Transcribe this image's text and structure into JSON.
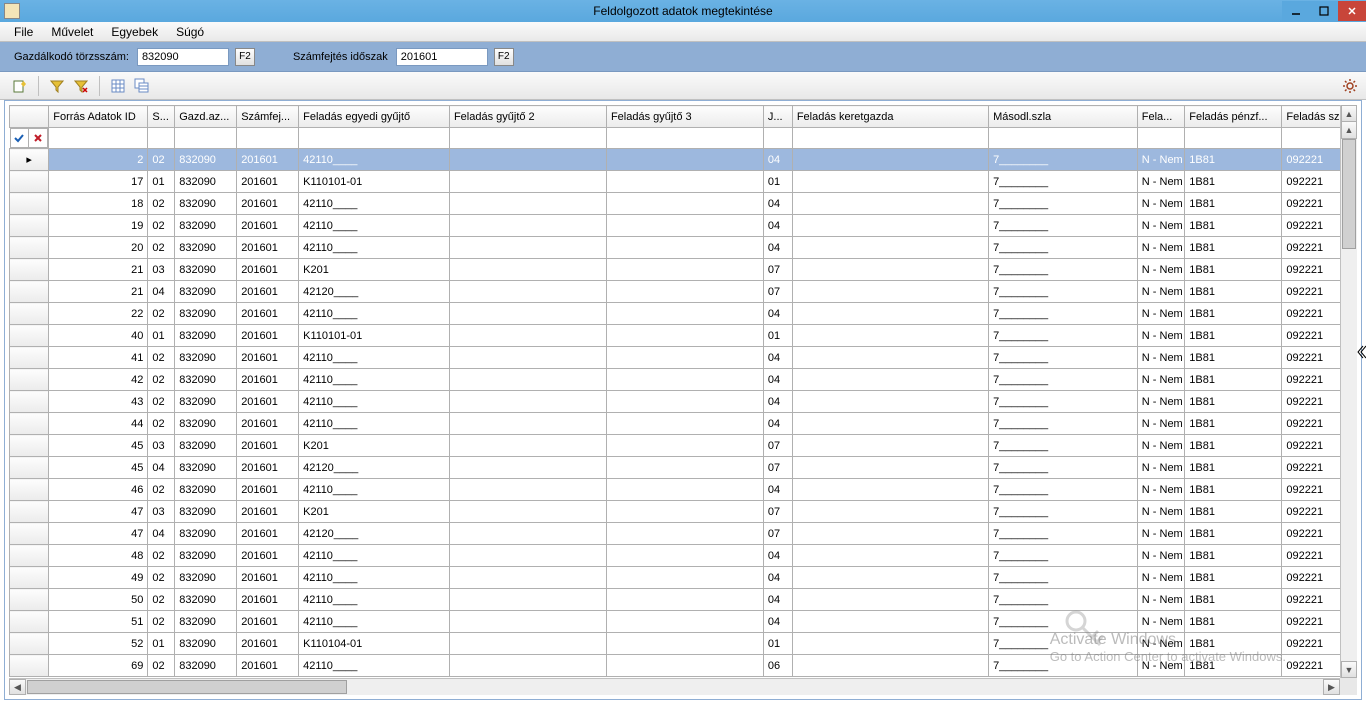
{
  "window": {
    "title": "Feldolgozott adatok megtekintése"
  },
  "menu": {
    "file": "File",
    "muvelet": "Művelet",
    "egyebek": "Egyebek",
    "sugo": "Súgó"
  },
  "params": {
    "torzsszam_label": "Gazdálkodó törzsszám:",
    "torzsszam_value": "832090",
    "idoszak_label": "Számfejtés időszak",
    "idoszak_value": "201601",
    "f2": "F2"
  },
  "columns": {
    "id": "Forrás Adatok ID",
    "s": "S...",
    "gazd": "Gazd.az...",
    "szam": "Számfej...",
    "egy": "Feladás egyedi gyűjtő",
    "gy2": "Feladás gyűjtő 2",
    "gy3": "Feladás gyűjtő 3",
    "j": "J...",
    "ker": "Feladás keretgazda",
    "masod": "Másodl.szla",
    "fela": "Fela...",
    "penz": "Feladás pénzf...",
    "szak": "Feladás szak"
  },
  "rows": [
    {
      "id": "2",
      "s": "02",
      "gazd": "832090",
      "szam": "201601",
      "egy": "42110____",
      "gy2": "",
      "gy3": "",
      "j": "04",
      "ker": "",
      "masod": "7________",
      "fela": "N - Nem",
      "penz": "1B81",
      "szak": "092221",
      "sel": true
    },
    {
      "id": "17",
      "s": "01",
      "gazd": "832090",
      "szam": "201601",
      "egy": "K110101-01",
      "gy2": "",
      "gy3": "",
      "j": "01",
      "ker": "",
      "masod": "7________",
      "fela": "N - Nem",
      "penz": "1B81",
      "szak": "092221"
    },
    {
      "id": "18",
      "s": "02",
      "gazd": "832090",
      "szam": "201601",
      "egy": "42110____",
      "gy2": "",
      "gy3": "",
      "j": "04",
      "ker": "",
      "masod": "7________",
      "fela": "N - Nem",
      "penz": "1B81",
      "szak": "092221"
    },
    {
      "id": "19",
      "s": "02",
      "gazd": "832090",
      "szam": "201601",
      "egy": "42110____",
      "gy2": "",
      "gy3": "",
      "j": "04",
      "ker": "",
      "masod": "7________",
      "fela": "N - Nem",
      "penz": "1B81",
      "szak": "092221"
    },
    {
      "id": "20",
      "s": "02",
      "gazd": "832090",
      "szam": "201601",
      "egy": "42110____",
      "gy2": "",
      "gy3": "",
      "j": "04",
      "ker": "",
      "masod": "7________",
      "fela": "N - Nem",
      "penz": "1B81",
      "szak": "092221"
    },
    {
      "id": "21",
      "s": "03",
      "gazd": "832090",
      "szam": "201601",
      "egy": "K201",
      "gy2": "",
      "gy3": "",
      "j": "07",
      "ker": "",
      "masod": "7________",
      "fela": "N - Nem",
      "penz": "1B81",
      "szak": "092221"
    },
    {
      "id": "21",
      "s": "04",
      "gazd": "832090",
      "szam": "201601",
      "egy": "42120____",
      "gy2": "",
      "gy3": "",
      "j": "07",
      "ker": "",
      "masod": "7________",
      "fela": "N - Nem",
      "penz": "1B81",
      "szak": "092221"
    },
    {
      "id": "22",
      "s": "02",
      "gazd": "832090",
      "szam": "201601",
      "egy": "42110____",
      "gy2": "",
      "gy3": "",
      "j": "04",
      "ker": "",
      "masod": "7________",
      "fela": "N - Nem",
      "penz": "1B81",
      "szak": "092221"
    },
    {
      "id": "40",
      "s": "01",
      "gazd": "832090",
      "szam": "201601",
      "egy": "K110101-01",
      "gy2": "",
      "gy3": "",
      "j": "01",
      "ker": "",
      "masod": "7________",
      "fela": "N - Nem",
      "penz": "1B81",
      "szak": "092221"
    },
    {
      "id": "41",
      "s": "02",
      "gazd": "832090",
      "szam": "201601",
      "egy": "42110____",
      "gy2": "",
      "gy3": "",
      "j": "04",
      "ker": "",
      "masod": "7________",
      "fela": "N - Nem",
      "penz": "1B81",
      "szak": "092221"
    },
    {
      "id": "42",
      "s": "02",
      "gazd": "832090",
      "szam": "201601",
      "egy": "42110____",
      "gy2": "",
      "gy3": "",
      "j": "04",
      "ker": "",
      "masod": "7________",
      "fela": "N - Nem",
      "penz": "1B81",
      "szak": "092221"
    },
    {
      "id": "43",
      "s": "02",
      "gazd": "832090",
      "szam": "201601",
      "egy": "42110____",
      "gy2": "",
      "gy3": "",
      "j": "04",
      "ker": "",
      "masod": "7________",
      "fela": "N - Nem",
      "penz": "1B81",
      "szak": "092221"
    },
    {
      "id": "44",
      "s": "02",
      "gazd": "832090",
      "szam": "201601",
      "egy": "42110____",
      "gy2": "",
      "gy3": "",
      "j": "04",
      "ker": "",
      "masod": "7________",
      "fela": "N - Nem",
      "penz": "1B81",
      "szak": "092221"
    },
    {
      "id": "45",
      "s": "03",
      "gazd": "832090",
      "szam": "201601",
      "egy": "K201",
      "gy2": "",
      "gy3": "",
      "j": "07",
      "ker": "",
      "masod": "7________",
      "fela": "N - Nem",
      "penz": "1B81",
      "szak": "092221"
    },
    {
      "id": "45",
      "s": "04",
      "gazd": "832090",
      "szam": "201601",
      "egy": "42120____",
      "gy2": "",
      "gy3": "",
      "j": "07",
      "ker": "",
      "masod": "7________",
      "fela": "N - Nem",
      "penz": "1B81",
      "szak": "092221"
    },
    {
      "id": "46",
      "s": "02",
      "gazd": "832090",
      "szam": "201601",
      "egy": "42110____",
      "gy2": "",
      "gy3": "",
      "j": "04",
      "ker": "",
      "masod": "7________",
      "fela": "N - Nem",
      "penz": "1B81",
      "szak": "092221"
    },
    {
      "id": "47",
      "s": "03",
      "gazd": "832090",
      "szam": "201601",
      "egy": "K201",
      "gy2": "",
      "gy3": "",
      "j": "07",
      "ker": "",
      "masod": "7________",
      "fela": "N - Nem",
      "penz": "1B81",
      "szak": "092221"
    },
    {
      "id": "47",
      "s": "04",
      "gazd": "832090",
      "szam": "201601",
      "egy": "42120____",
      "gy2": "",
      "gy3": "",
      "j": "07",
      "ker": "",
      "masod": "7________",
      "fela": "N - Nem",
      "penz": "1B81",
      "szak": "092221"
    },
    {
      "id": "48",
      "s": "02",
      "gazd": "832090",
      "szam": "201601",
      "egy": "42110____",
      "gy2": "",
      "gy3": "",
      "j": "04",
      "ker": "",
      "masod": "7________",
      "fela": "N - Nem",
      "penz": "1B81",
      "szak": "092221"
    },
    {
      "id": "49",
      "s": "02",
      "gazd": "832090",
      "szam": "201601",
      "egy": "42110____",
      "gy2": "",
      "gy3": "",
      "j": "04",
      "ker": "",
      "masod": "7________",
      "fela": "N - Nem",
      "penz": "1B81",
      "szak": "092221"
    },
    {
      "id": "50",
      "s": "02",
      "gazd": "832090",
      "szam": "201601",
      "egy": "42110____",
      "gy2": "",
      "gy3": "",
      "j": "04",
      "ker": "",
      "masod": "7________",
      "fela": "N - Nem",
      "penz": "1B81",
      "szak": "092221"
    },
    {
      "id": "51",
      "s": "02",
      "gazd": "832090",
      "szam": "201601",
      "egy": "42110____",
      "gy2": "",
      "gy3": "",
      "j": "04",
      "ker": "",
      "masod": "7________",
      "fela": "N - Nem",
      "penz": "1B81",
      "szak": "092221"
    },
    {
      "id": "52",
      "s": "01",
      "gazd": "832090",
      "szam": "201601",
      "egy": "K110104-01",
      "gy2": "",
      "gy3": "",
      "j": "01",
      "ker": "",
      "masod": "7________",
      "fela": "N - Nem",
      "penz": "1B81",
      "szak": "092221"
    },
    {
      "id": "69",
      "s": "02",
      "gazd": "832090",
      "szam": "201601",
      "egy": "42110____",
      "gy2": "",
      "gy3": "",
      "j": "06",
      "ker": "",
      "masod": "7________",
      "fela": "N - Nem",
      "penz": "1B81",
      "szak": "092221"
    }
  ],
  "watermark": {
    "line1": "Activate Windows",
    "line2": "Go to Action Center to activate Windows."
  }
}
